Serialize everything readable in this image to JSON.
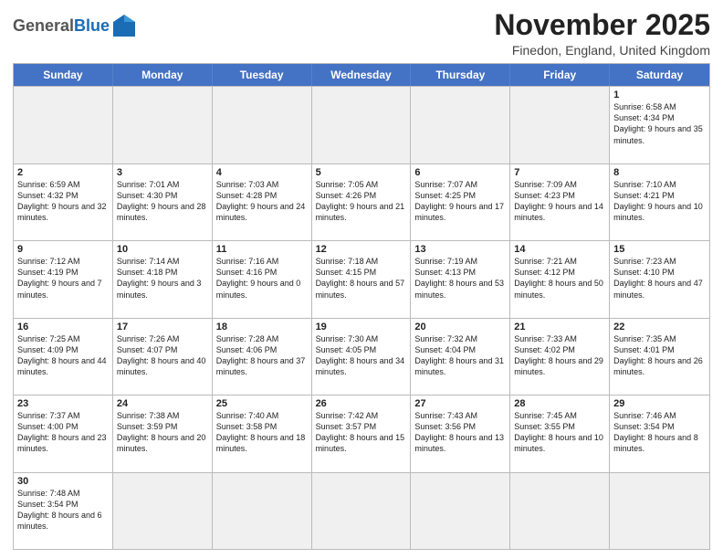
{
  "header": {
    "logo_general": "General",
    "logo_blue": "Blue",
    "month_year": "November 2025",
    "location": "Finedon, England, United Kingdom"
  },
  "weekdays": [
    "Sunday",
    "Monday",
    "Tuesday",
    "Wednesday",
    "Thursday",
    "Friday",
    "Saturday"
  ],
  "rows": [
    [
      {
        "day": "",
        "info": "",
        "empty": true
      },
      {
        "day": "",
        "info": "",
        "empty": true
      },
      {
        "day": "",
        "info": "",
        "empty": true
      },
      {
        "day": "",
        "info": "",
        "empty": true
      },
      {
        "day": "",
        "info": "",
        "empty": true
      },
      {
        "day": "",
        "info": "",
        "empty": true
      },
      {
        "day": "1",
        "info": "Sunrise: 6:58 AM\nSunset: 4:34 PM\nDaylight: 9 hours and 35 minutes.",
        "empty": false
      }
    ],
    [
      {
        "day": "2",
        "info": "Sunrise: 6:59 AM\nSunset: 4:32 PM\nDaylight: 9 hours and 32 minutes.",
        "empty": false
      },
      {
        "day": "3",
        "info": "Sunrise: 7:01 AM\nSunset: 4:30 PM\nDaylight: 9 hours and 28 minutes.",
        "empty": false
      },
      {
        "day": "4",
        "info": "Sunrise: 7:03 AM\nSunset: 4:28 PM\nDaylight: 9 hours and 24 minutes.",
        "empty": false
      },
      {
        "day": "5",
        "info": "Sunrise: 7:05 AM\nSunset: 4:26 PM\nDaylight: 9 hours and 21 minutes.",
        "empty": false
      },
      {
        "day": "6",
        "info": "Sunrise: 7:07 AM\nSunset: 4:25 PM\nDaylight: 9 hours and 17 minutes.",
        "empty": false
      },
      {
        "day": "7",
        "info": "Sunrise: 7:09 AM\nSunset: 4:23 PM\nDaylight: 9 hours and 14 minutes.",
        "empty": false
      },
      {
        "day": "8",
        "info": "Sunrise: 7:10 AM\nSunset: 4:21 PM\nDaylight: 9 hours and 10 minutes.",
        "empty": false
      }
    ],
    [
      {
        "day": "9",
        "info": "Sunrise: 7:12 AM\nSunset: 4:19 PM\nDaylight: 9 hours and 7 minutes.",
        "empty": false
      },
      {
        "day": "10",
        "info": "Sunrise: 7:14 AM\nSunset: 4:18 PM\nDaylight: 9 hours and 3 minutes.",
        "empty": false
      },
      {
        "day": "11",
        "info": "Sunrise: 7:16 AM\nSunset: 4:16 PM\nDaylight: 9 hours and 0 minutes.",
        "empty": false
      },
      {
        "day": "12",
        "info": "Sunrise: 7:18 AM\nSunset: 4:15 PM\nDaylight: 8 hours and 57 minutes.",
        "empty": false
      },
      {
        "day": "13",
        "info": "Sunrise: 7:19 AM\nSunset: 4:13 PM\nDaylight: 8 hours and 53 minutes.",
        "empty": false
      },
      {
        "day": "14",
        "info": "Sunrise: 7:21 AM\nSunset: 4:12 PM\nDaylight: 8 hours and 50 minutes.",
        "empty": false
      },
      {
        "day": "15",
        "info": "Sunrise: 7:23 AM\nSunset: 4:10 PM\nDaylight: 8 hours and 47 minutes.",
        "empty": false
      }
    ],
    [
      {
        "day": "16",
        "info": "Sunrise: 7:25 AM\nSunset: 4:09 PM\nDaylight: 8 hours and 44 minutes.",
        "empty": false
      },
      {
        "day": "17",
        "info": "Sunrise: 7:26 AM\nSunset: 4:07 PM\nDaylight: 8 hours and 40 minutes.",
        "empty": false
      },
      {
        "day": "18",
        "info": "Sunrise: 7:28 AM\nSunset: 4:06 PM\nDaylight: 8 hours and 37 minutes.",
        "empty": false
      },
      {
        "day": "19",
        "info": "Sunrise: 7:30 AM\nSunset: 4:05 PM\nDaylight: 8 hours and 34 minutes.",
        "empty": false
      },
      {
        "day": "20",
        "info": "Sunrise: 7:32 AM\nSunset: 4:04 PM\nDaylight: 8 hours and 31 minutes.",
        "empty": false
      },
      {
        "day": "21",
        "info": "Sunrise: 7:33 AM\nSunset: 4:02 PM\nDaylight: 8 hours and 29 minutes.",
        "empty": false
      },
      {
        "day": "22",
        "info": "Sunrise: 7:35 AM\nSunset: 4:01 PM\nDaylight: 8 hours and 26 minutes.",
        "empty": false
      }
    ],
    [
      {
        "day": "23",
        "info": "Sunrise: 7:37 AM\nSunset: 4:00 PM\nDaylight: 8 hours and 23 minutes.",
        "empty": false
      },
      {
        "day": "24",
        "info": "Sunrise: 7:38 AM\nSunset: 3:59 PM\nDaylight: 8 hours and 20 minutes.",
        "empty": false
      },
      {
        "day": "25",
        "info": "Sunrise: 7:40 AM\nSunset: 3:58 PM\nDaylight: 8 hours and 18 minutes.",
        "empty": false
      },
      {
        "day": "26",
        "info": "Sunrise: 7:42 AM\nSunset: 3:57 PM\nDaylight: 8 hours and 15 minutes.",
        "empty": false
      },
      {
        "day": "27",
        "info": "Sunrise: 7:43 AM\nSunset: 3:56 PM\nDaylight: 8 hours and 13 minutes.",
        "empty": false
      },
      {
        "day": "28",
        "info": "Sunrise: 7:45 AM\nSunset: 3:55 PM\nDaylight: 8 hours and 10 minutes.",
        "empty": false
      },
      {
        "day": "29",
        "info": "Sunrise: 7:46 AM\nSunset: 3:54 PM\nDaylight: 8 hours and 8 minutes.",
        "empty": false
      }
    ],
    [
      {
        "day": "30",
        "info": "Sunrise: 7:48 AM\nSunset: 3:54 PM\nDaylight: 8 hours and 6 minutes.",
        "empty": false
      },
      {
        "day": "",
        "info": "",
        "empty": true
      },
      {
        "day": "",
        "info": "",
        "empty": true
      },
      {
        "day": "",
        "info": "",
        "empty": true
      },
      {
        "day": "",
        "info": "",
        "empty": true
      },
      {
        "day": "",
        "info": "",
        "empty": true
      },
      {
        "day": "",
        "info": "",
        "empty": true
      }
    ]
  ]
}
